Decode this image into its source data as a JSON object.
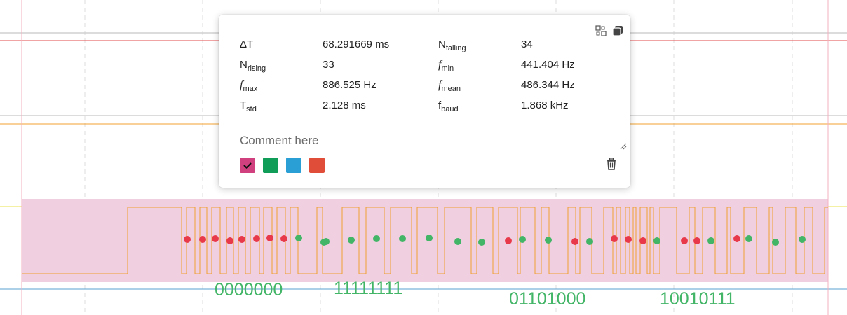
{
  "popup": {
    "metrics": [
      {
        "sym": "ΔT",
        "sub": "",
        "italic": false,
        "value": "68.291669 ms"
      },
      {
        "sym": "N",
        "sub": "falling",
        "italic": false,
        "value": "34"
      },
      {
        "sym": "N",
        "sub": "rising",
        "italic": false,
        "value": "33"
      },
      {
        "sym": "f",
        "sub": "min",
        "italic": true,
        "value": "441.404 Hz"
      },
      {
        "sym": "f",
        "sub": "max",
        "italic": true,
        "value": "886.525 Hz"
      },
      {
        "sym": "f",
        "sub": "mean",
        "italic": true,
        "value": "486.344 Hz"
      },
      {
        "sym": "T",
        "sub": "std",
        "italic": false,
        "value": "2.128 ms"
      },
      {
        "sym": "f",
        "sub": "baud",
        "italic": false,
        "value": "1.868 kHz"
      }
    ],
    "comment_placeholder": "Comment here",
    "swatches": [
      {
        "color": "#d0407f",
        "selected": true
      },
      {
        "color": "#0f9d58",
        "selected": false
      },
      {
        "color": "#2a9fd6",
        "selected": false
      },
      {
        "color": "#e04e39",
        "selected": false
      }
    ],
    "icons": [
      "shrink-view-icon",
      "copy-icon",
      "resize-handle-icon",
      "trash-icon"
    ]
  },
  "decoded_bits": [
    "0000000",
    "11111111",
    "01101000",
    "10010111"
  ],
  "colors": {
    "selection": "#f0d0e0",
    "signal": "#f0a030",
    "rising_marker": "#e8394a",
    "falling_marker": "#43b567",
    "decode_text": "#43b567"
  }
}
